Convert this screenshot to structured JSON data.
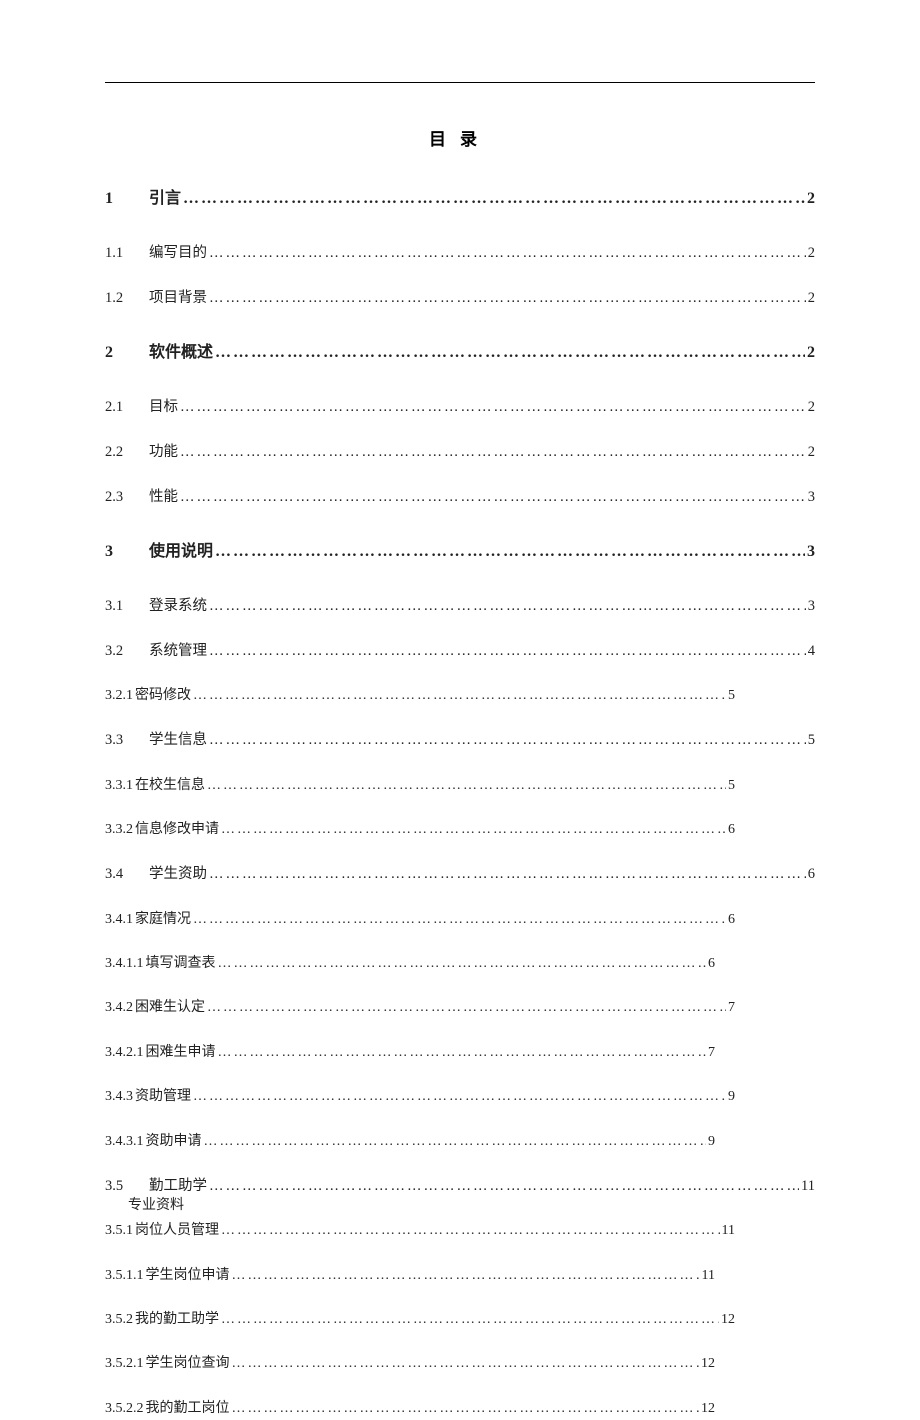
{
  "title": "目录",
  "footer": "专业资料",
  "entries": [
    {
      "level": 1,
      "num": "1",
      "label": "引言",
      "page": "2"
    },
    {
      "level": 2,
      "num": "1.1",
      "label": "编写目的",
      "page": "2"
    },
    {
      "level": 2,
      "num": "1.2",
      "label": "项目背景",
      "page": "2"
    },
    {
      "level": 1,
      "num": "2",
      "label": "软件概述",
      "page": "2"
    },
    {
      "level": 2,
      "num": "2.1",
      "label": "目标",
      "page": "2"
    },
    {
      "level": 2,
      "num": "2.2",
      "label": "功能",
      "page": "2"
    },
    {
      "level": 2,
      "num": "2.3",
      "label": "性能",
      "page": "3"
    },
    {
      "level": 1,
      "num": "3",
      "label": "使用说明",
      "page": "3"
    },
    {
      "level": 2,
      "num": "3.1",
      "label": "登录系统",
      "page": "3"
    },
    {
      "level": 2,
      "num": "3.2",
      "label": "系统管理",
      "page": "4"
    },
    {
      "level": 3,
      "num": "3.2.1",
      "label": "密码修改",
      "page": "5"
    },
    {
      "level": 2,
      "num": "3.3",
      "label": "学生信息",
      "page": "5"
    },
    {
      "level": 3,
      "num": "3.3.1",
      "label": "在校生信息",
      "page": "5"
    },
    {
      "level": 3,
      "num": "3.3.2",
      "label": "信息修改申请",
      "page": "6"
    },
    {
      "level": 2,
      "num": "3.4",
      "label": "学生资助",
      "page": "6"
    },
    {
      "level": 3,
      "num": "3.4.1",
      "label": "家庭情况",
      "page": "6"
    },
    {
      "level": 4,
      "num": "3.4.1.1",
      "label": "填写调查表",
      "page": "6"
    },
    {
      "level": 3,
      "num": "3.4.2",
      "label": "困难生认定",
      "page": "7"
    },
    {
      "level": 4,
      "num": "3.4.2.1",
      "label": "困难生申请",
      "page": "7"
    },
    {
      "level": 3,
      "num": "3.4.3",
      "label": "资助管理",
      "page": "9"
    },
    {
      "level": 4,
      "num": "3.4.3.1",
      "label": "资助申请",
      "page": "9"
    },
    {
      "level": 2,
      "num": "3.5",
      "label": "勤工助学",
      "page": "11"
    },
    {
      "level": 3,
      "num": "3.5.1",
      "label": "岗位人员管理",
      "page": "11"
    },
    {
      "level": 4,
      "num": "3.5.1.1",
      "label": "学生岗位申请",
      "page": "11"
    },
    {
      "level": 3,
      "num": "3.5.2",
      "label": "我的勤工助学",
      "page": "12"
    },
    {
      "level": 4,
      "num": "3.5.2.1",
      "label": "学生岗位查询",
      "page": "12"
    },
    {
      "level": 4,
      "num": "3.5.2.2",
      "label": "我的勤工岗位",
      "page": "12"
    }
  ]
}
